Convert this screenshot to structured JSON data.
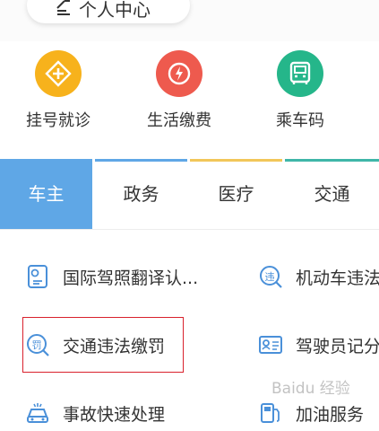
{
  "header": {
    "profile_label": "个人中心"
  },
  "quick_services": [
    {
      "label": "挂号就诊",
      "icon": "medical-cross-icon",
      "color": "#f7b21c"
    },
    {
      "label": "生活缴费",
      "icon": "power-bolt-icon",
      "color": "#ee5a4e"
    },
    {
      "label": "乘车码",
      "icon": "bus-icon",
      "color": "#25b68a"
    }
  ],
  "tabs": [
    {
      "label": "车主",
      "active": true,
      "accent": "#5fa7e6"
    },
    {
      "label": "政务",
      "active": false,
      "accent": "#5fa7e6"
    },
    {
      "label": "医疗",
      "active": false,
      "accent": "#f2c75a"
    },
    {
      "label": "交通",
      "active": false,
      "accent": "#3fb6a8"
    }
  ],
  "services": [
    {
      "label": "国际驾照翻译认...",
      "icon": "license-doc-icon"
    },
    {
      "label": "机动车违法",
      "icon": "violation-search-icon"
    },
    {
      "label": "交通违法缴罚",
      "icon": "fine-search-icon",
      "highlighted": true
    },
    {
      "label": "驾驶员记分",
      "icon": "id-card-icon"
    },
    {
      "label": "事故快速处理",
      "icon": "accident-car-icon"
    },
    {
      "label": "加油服务",
      "icon": "fuel-pump-icon"
    }
  ],
  "watermark": "Baidu 经验",
  "colors": {
    "primary": "#5fa7e6",
    "icon_blue": "#4a90d9",
    "highlight": "#d9212d"
  }
}
